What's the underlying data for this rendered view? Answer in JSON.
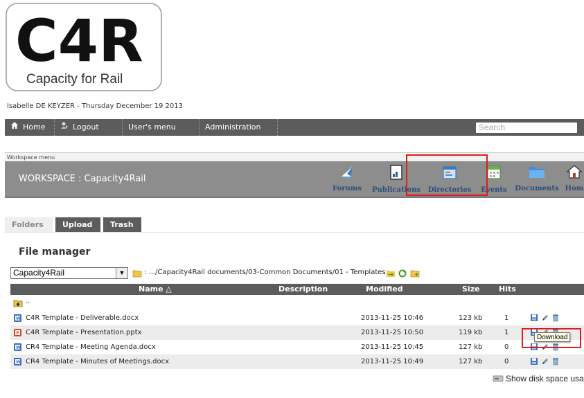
{
  "logo": {
    "letters": "C4R",
    "tagline": "Capacity for Rail"
  },
  "user_line": "Isabelle DE KEYZER  - Thursday December 19 2013",
  "nav": {
    "home": "Home",
    "logout": "Logout",
    "user_menu": "User's menu",
    "administration": "Administration",
    "search_placeholder": "Search"
  },
  "workspace": {
    "menu_label": "Workspace menu",
    "title": "WORKSPACE : Capacity4Rail",
    "icons": [
      {
        "label": "Forums",
        "icon": "forums-icon"
      },
      {
        "label": "Publications",
        "icon": "publications-icon"
      },
      {
        "label": "Directories",
        "icon": "directories-icon"
      },
      {
        "label": "Events",
        "icon": "events-icon"
      },
      {
        "label": "Documents",
        "icon": "documents-icon"
      },
      {
        "label": "Hom",
        "icon": "home-icon"
      }
    ]
  },
  "tabs": {
    "folders": "Folders",
    "upload": "Upload",
    "trash": "Trash"
  },
  "file_manager": {
    "title": "File manager",
    "folder_select": "Capacity4Rail",
    "path": ": .../Capacity4Rail documents/03-Common Documents/01 - Templates",
    "columns": {
      "name": "Name △",
      "description": "Description",
      "modified": "Modified",
      "size": "Size",
      "hits": "Hits"
    },
    "parent": "..",
    "files": [
      {
        "name": "C4R Template - Deliverable.docx",
        "type": "docx",
        "modified": "2013-11-25 10:46",
        "size": "123 kb",
        "hits": "1"
      },
      {
        "name": "C4R Template - Presentation.pptx",
        "type": "pptx",
        "modified": "2013-11-25 10:50",
        "size": "119 kb",
        "hits": "1"
      },
      {
        "name": "CR4 Template - Meeting Agenda.docx",
        "type": "docx",
        "modified": "2013-11-25 10:45",
        "size": "127 kb",
        "hits": "0"
      },
      {
        "name": "CR4 Template - Minutes of Meetings.docx",
        "type": "docx",
        "modified": "2013-11-25 10:49",
        "size": "127 kb",
        "hits": "0"
      }
    ],
    "tooltip": "Download",
    "disk_usage": "Show disk space usage"
  },
  "colors": {
    "bar": "#5c5c5c",
    "workspace": "#8d8d8d",
    "highlight": "#e01b1b",
    "link": "#2d4d7a"
  }
}
